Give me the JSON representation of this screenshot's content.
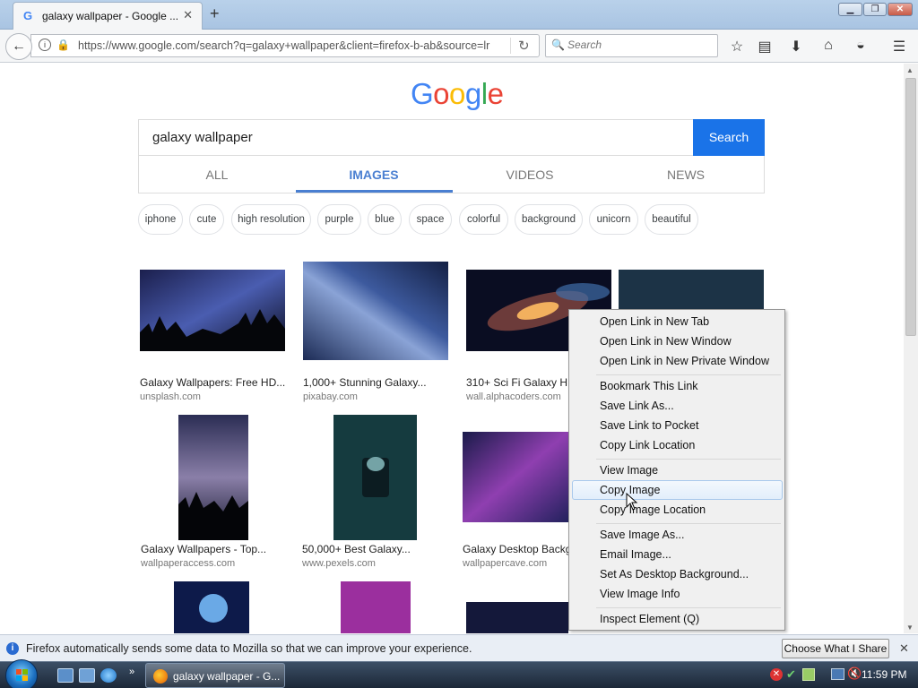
{
  "browser": {
    "tab_title": "galaxy wallpaper - Google ...",
    "url": "https://www.google.com/search?q=galaxy+wallpaper&client=firefox-b-ab&source=lr",
    "search_placeholder": "Search"
  },
  "google": {
    "logo_letters": [
      "G",
      "o",
      "o",
      "g",
      "l",
      "e"
    ],
    "query": "galaxy wallpaper",
    "search_button": "Search",
    "tabs": [
      "ALL",
      "IMAGES",
      "VIDEOS",
      "NEWS"
    ],
    "active_tab": "IMAGES",
    "chips": [
      "iphone",
      "cute",
      "high resolution",
      "purple",
      "blue",
      "space",
      "colorful",
      "background",
      "unicorn",
      "beautiful"
    ]
  },
  "results": [
    {
      "caption": "Galaxy Wallpapers: Free HD...",
      "source": "unsplash.com"
    },
    {
      "caption": "1,000+ Stunning Galaxy...",
      "source": "pixabay.com"
    },
    {
      "caption": "310+ Sci Fi Galaxy H",
      "source": "wall.alphacoders.com"
    },
    {
      "caption": "Galaxy Wallpapers - Top...",
      "source": "wallpaperaccess.com"
    },
    {
      "caption": "50,000+ Best Galaxy...",
      "source": "www.pexels.com"
    },
    {
      "caption": "Galaxy Desktop Backg",
      "source": "wallpapercave.com"
    }
  ],
  "context_menu": {
    "items": [
      "Open Link in New Tab",
      "Open Link in New Window",
      "Open Link in New Private Window",
      "Bookmark This Link",
      "Save Link As...",
      "Save Link to Pocket",
      "Copy Link Location",
      "View Image",
      "Copy Image",
      "Copy Image Location",
      "Save Image As...",
      "Email Image...",
      "Set As Desktop Background...",
      "View Image Info",
      "Inspect Element (Q)"
    ],
    "highlighted": "Copy Image"
  },
  "notification": {
    "text": "Firefox automatically sends some data to Mozilla so that we can improve your experience.",
    "button": "Choose What I Share"
  },
  "taskbar": {
    "task_label": "galaxy wallpaper - G...",
    "clock": "11:59 PM"
  },
  "colors": {
    "google_blue": "#4285f4",
    "search_button": "#1a73e8",
    "active_tab": "#4a7fd1"
  }
}
